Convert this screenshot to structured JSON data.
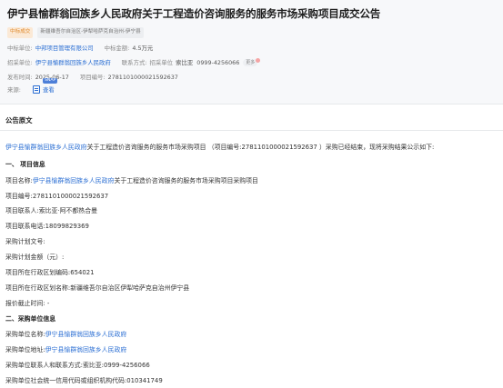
{
  "title": "伊宁县愉群翁回族乡人民政府关于工程造价咨询服务的服务市场采购项目成交公告",
  "tags": [
    "中标成交",
    "新疆维吾尔自治区-伊犁哈萨克自治州-伊宁县"
  ],
  "meta": {
    "winner_label": "中标单位:",
    "winner": "中邦项目管理有限公司",
    "amount_label": "中标金额:",
    "amount": "4.5万元",
    "buyer_label": "招采单位:",
    "buyer": "伊宁县愉群翁回族乡人民政府",
    "contact_label": "联系方式:",
    "contact_buyer_label": "招采单位",
    "contact_person": "索比亚",
    "contact_phone": "0999-4256066",
    "more": "更多",
    "publish_label": "发布时间:",
    "publish_date": "2025-06-17",
    "project_no_label": "项目编号:",
    "project_no": "2781101000021592637",
    "source_label": "来源:",
    "snapshot": "SNAP",
    "view": "查看"
  },
  "section_title": "公告原文",
  "intro": {
    "entity": "伊宁县愉群翁回族乡人民政府",
    "text": "关于工程造价咨询服务的服务市场采购项目 （项目编号:2781101000021592637 ）采购已经结束，现将采购结果公示如下:"
  },
  "lines": [
    {
      "text": "一、 项目信息",
      "bold": true
    },
    {
      "prefix": "项目名称:",
      "link": "伊宁县愉群翁回族乡人民政府",
      "suffix": "关于工程造价咨询服务的服务市场采购项目采购项目"
    },
    {
      "text": "项目编号:2781101000021592637"
    },
    {
      "text": "项目联系人:索比亚·阿不都热合曼"
    },
    {
      "text": "项目联系电话:18099829369"
    },
    {
      "text": "采购计划文号:"
    },
    {
      "text": "采购计划金额（元）:"
    },
    {
      "text": "项目所在行政区划编码:654021"
    },
    {
      "text": "项目所在行政区划名称:新疆维吾尔自治区伊犁哈萨克自治州伊宁县"
    },
    {
      "text": "报价截止时间: -"
    },
    {
      "text": "二、采购单位信息",
      "bold": true
    },
    {
      "prefix": "采购单位名称:",
      "link": "伊宁县愉群翁回族乡人民政府",
      "suffix": ""
    },
    {
      "prefix": "采购单位地址:",
      "link": "伊宁县愉群翁回族乡人民政府",
      "suffix": ""
    },
    {
      "text": "采购单位联系人和联系方式:索比亚:0999-4256066"
    },
    {
      "text": "采购单位社会统一信用代码或组织机构代码:010341749"
    }
  ],
  "colors": {
    "link": "#2a6ed3",
    "tag_orange": "#e08a2e",
    "header_bg": "#f7f8fa"
  }
}
